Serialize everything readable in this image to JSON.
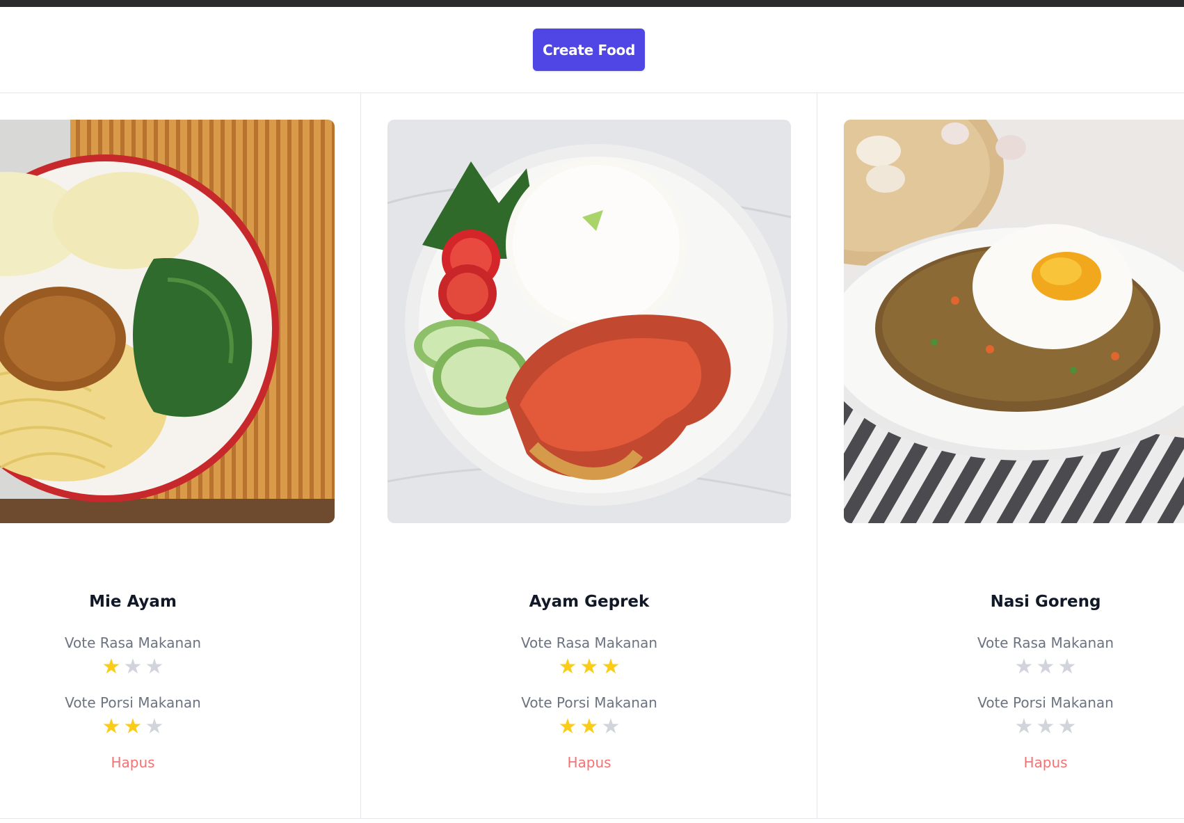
{
  "header": {
    "create_label": "Create Food"
  },
  "colors": {
    "accent": "#4f46e5",
    "star_on": "#facc15",
    "star_off": "#d1d5db",
    "delete": "#f87171"
  },
  "foods": [
    {
      "name": "Mie Ayam",
      "rasa_label": "Vote Rasa Makanan",
      "porsi_label": "Vote Porsi Makanan",
      "rasa": 1,
      "porsi": 2,
      "max": 3,
      "delete_label": "Hapus"
    },
    {
      "name": "Ayam Geprek",
      "rasa_label": "Vote Rasa Makanan",
      "porsi_label": "Vote Porsi Makanan",
      "rasa": 3,
      "porsi": 2,
      "max": 3,
      "delete_label": "Hapus"
    },
    {
      "name": "Nasi Goreng",
      "rasa_label": "Vote Rasa Makanan",
      "porsi_label": "Vote Porsi Makanan",
      "rasa": 0,
      "porsi": 0,
      "max": 3,
      "delete_label": "Hapus"
    }
  ]
}
